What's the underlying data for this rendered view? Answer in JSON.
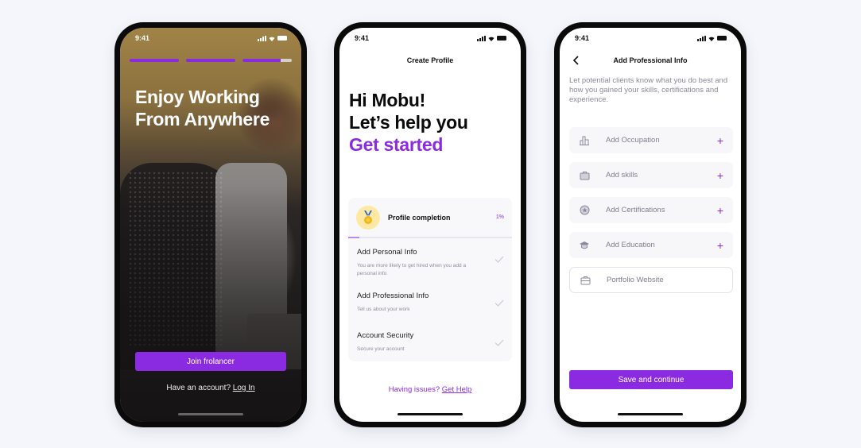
{
  "colors": {
    "accent": "#8a2be2",
    "background": "#f5f6fb",
    "medal_bg": "#fde9a4"
  },
  "phones": [
    {
      "status": {
        "time": "9:41"
      },
      "onboarding_progress": [
        1.0,
        1.0,
        0.78
      ],
      "hero_title_line1": "Enjoy Working",
      "hero_title_line2": "From Anywhere",
      "join_button": "Join frolancer",
      "have_account_text": "Have an account?",
      "login_link": "Log In"
    },
    {
      "status": {
        "time": "9:41"
      },
      "nav_title": "Create Profile",
      "greeting_line1": "Hi Mobu!",
      "greeting_line2": "Let’s help you",
      "greeting_line3": "Get started",
      "profile_card": {
        "icon": "medal-icon",
        "title": "Profile completion",
        "percent_label": "1%",
        "percent": 1,
        "tasks": [
          {
            "title": "Add Personal Info",
            "subtitle": "You are more likely to get hired when you add a personal info",
            "icon": "check-icon"
          },
          {
            "title": "Add Professional Info",
            "subtitle": "Tell us about your work",
            "icon": "check-icon"
          },
          {
            "title": "Account Security",
            "subtitle": "Secure your account",
            "icon": "check-icon"
          }
        ]
      },
      "help_text": "Having issues?",
      "help_link": "Get Help"
    },
    {
      "status": {
        "time": "9:41"
      },
      "nav_title": "Add Professional Info",
      "back_icon": "chevron-left-icon",
      "description": "Let potential clients know what you do best and how you gained your skills, certifications and experience.",
      "fields": [
        {
          "label": "Add Occupation",
          "icon": "building-icon",
          "action": "+"
        },
        {
          "label": "Add skills",
          "icon": "briefcase-icon",
          "action": "+"
        },
        {
          "label": "Add Certifications",
          "icon": "badge-icon",
          "action": "+"
        },
        {
          "label": "Add Education",
          "icon": "graduation-cap-icon",
          "action": "+"
        }
      ],
      "portfolio_placeholder": "Portfolio Website",
      "save_button": "Save and continue"
    }
  ]
}
